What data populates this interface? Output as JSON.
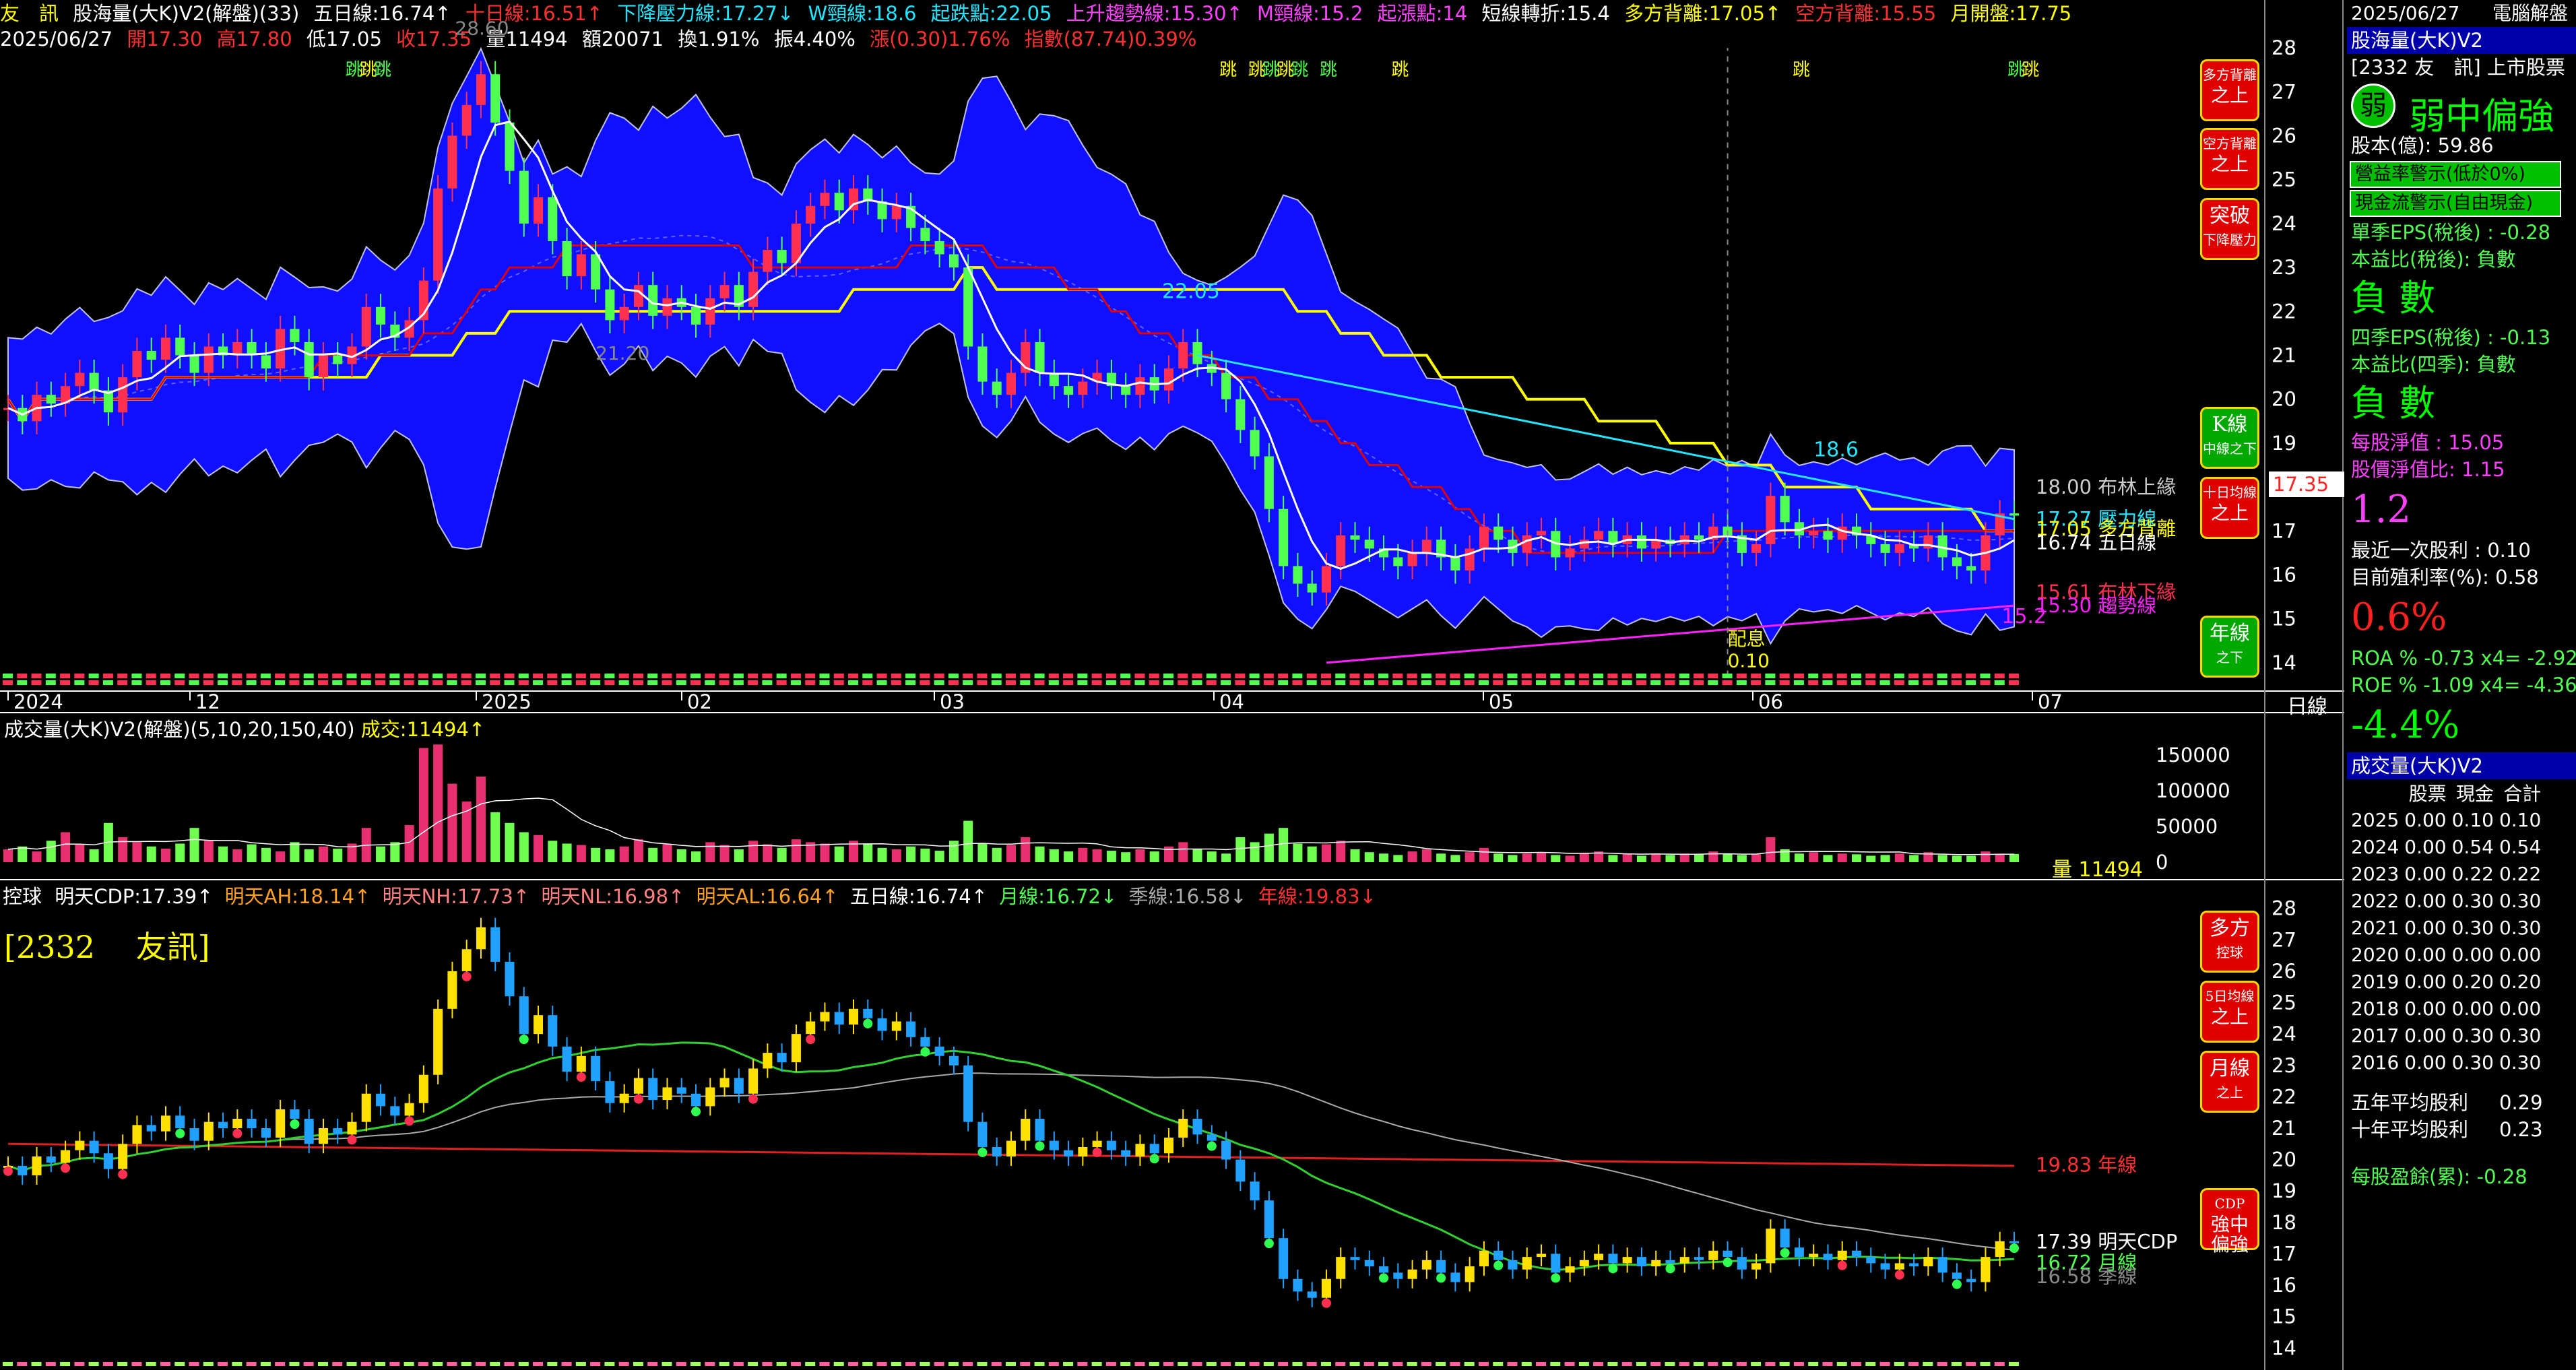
{
  "colors": {
    "up": "#ff3050",
    "down": "#50ff50",
    "band": "#1010ff",
    "yellow": "#ffff00",
    "cyan": "#22e6ff",
    "magenta": "#ff20ff",
    "red": "#ff2020"
  },
  "header1": {
    "stock": "友　訊",
    "indicator": "股海量(大K)V2(解盤)(33)",
    "ma5": "五日線:16.74↑",
    "ma10": "十日線:16.51↑",
    "down_pressure": "下降壓力線:17.27↓",
    "w_neck": "W頸線:18.6",
    "jump_down": "起跌點:22.05",
    "up_trend": "上升趨勢線:15.30↑",
    "m_neck": "M頸線:15.2",
    "jump_up": "起漲點:14",
    "short_turn": "短線轉折:15.4",
    "bull_div": "多方背離:17.05↑",
    "bear_div": "空方背離:15.55",
    "month_open": "月開盤:17.75"
  },
  "header2": {
    "date": "2025/06/27",
    "open": "開17.30",
    "high": "高17.80",
    "low": "低17.05",
    "close": "收17.35",
    "volume": "量11494",
    "amount": "額20071",
    "turnover": "換1.91%",
    "amplitude": "振4.40%",
    "change": "漲(0.30)1.76%",
    "index": "指數(87.74)0.39%"
  },
  "chart_data": [
    {
      "type": "candlestick",
      "title": "股海量(大K)V2(解盤)(33)",
      "x_ticks": [
        "2024",
        "12",
        "2025",
        "02",
        "03",
        "04",
        "05",
        "06",
        "07"
      ],
      "x_axis_label": "日線",
      "y_ticks": [
        14,
        15,
        16,
        17,
        18,
        19,
        20,
        21,
        22,
        23,
        24,
        25,
        26,
        27,
        28
      ],
      "ylim": [
        13.6,
        28.4
      ],
      "current_price": "17.35",
      "close_series": [
        19.8,
        19.5,
        20.1,
        19.9,
        20.3,
        20.6,
        20.2,
        19.7,
        20.5,
        21.1,
        20.9,
        21.4,
        21.0,
        20.6,
        21.2,
        21.0,
        21.3,
        21.0,
        20.7,
        21.6,
        21.3,
        20.5,
        21.0,
        20.8,
        21.2,
        22.1,
        21.7,
        21.4,
        21.8,
        22.7,
        24.8,
        26.0,
        26.7,
        27.4,
        26.3,
        25.2,
        24.0,
        24.6,
        23.6,
        22.8,
        23.3,
        22.5,
        21.8,
        22.1,
        22.6,
        21.9,
        22.3,
        22.1,
        21.7,
        22.3,
        22.6,
        22.1,
        22.9,
        23.4,
        23.1,
        24.0,
        24.4,
        24.7,
        24.3,
        24.8,
        24.5,
        24.1,
        24.4,
        23.9,
        23.6,
        23.3,
        23.0,
        21.2,
        20.4,
        20.1,
        20.6,
        21.3,
        20.6,
        20.3,
        20.1,
        20.4,
        20.6,
        20.3,
        20.1,
        20.5,
        20.2,
        20.7,
        21.3,
        20.8,
        20.6,
        20.0,
        19.3,
        18.7,
        17.5,
        16.2,
        15.8,
        15.6,
        16.2,
        16.9,
        16.8,
        16.6,
        16.4,
        16.2,
        16.5,
        16.8,
        16.4,
        16.1,
        16.6,
        17.1,
        16.8,
        16.5,
        16.9,
        17.0,
        16.4,
        16.6,
        16.8,
        17.0,
        16.7,
        16.9,
        16.6,
        16.8,
        16.7,
        16.9,
        16.8,
        17.1,
        16.9,
        16.5,
        16.7,
        17.8,
        17.2,
        16.9,
        17.0,
        16.8,
        17.1,
        16.9,
        16.7,
        16.5,
        16.7,
        16.6,
        16.9,
        16.4,
        16.2,
        16.1,
        16.9,
        17.4,
        17.35
      ],
      "ma_labels": [
        "18.00 布林上緣",
        "17.27 壓力線",
        "17.05 多方背離",
        "16.74 五日線",
        "15.61 布林下緣",
        "15.30 趨勢線"
      ],
      "annotations": {
        "high": "28.60",
        "low_mark": "21.20",
        "jump_down": "22.05",
        "w_neck": "18.6",
        "m_neck": "15.2",
        "dividend": "配息",
        "dividend_value": "0.10",
        "jump_label": "跳"
      }
    },
    {
      "type": "bar",
      "title": "成交量(大K)V2(解盤)(5,10,20,150,40)",
      "current": "成交:11494↑",
      "y_ticks": [
        "150000",
        "100000",
        "50000",
        "0"
      ],
      "ylim": [
        0,
        170000
      ],
      "volume_label": "量 11494",
      "values": [
        18000,
        22000,
        15000,
        30000,
        42000,
        25000,
        18000,
        55000,
        35000,
        28000,
        22000,
        19000,
        26000,
        48000,
        30000,
        22000,
        18000,
        25000,
        20000,
        15000,
        28000,
        18000,
        22000,
        19000,
        26000,
        48000,
        22000,
        28000,
        52000,
        160000,
        165000,
        110000,
        85000,
        120000,
        70000,
        55000,
        42000,
        38000,
        30000,
        26000,
        24000,
        20000,
        18000,
        22000,
        32000,
        20000,
        25000,
        18000,
        15000,
        28000,
        24000,
        18000,
        30000,
        25000,
        20000,
        32000,
        28000,
        26000,
        22000,
        30000,
        25000,
        20000,
        18000,
        22000,
        19000,
        16000,
        30000,
        58000,
        26000,
        20000,
        24000,
        35000,
        22000,
        18000,
        15000,
        20000,
        18000,
        16000,
        14000,
        18000,
        15000,
        22000,
        28000,
        18000,
        15000,
        12000,
        35000,
        28000,
        40000,
        48000,
        26000,
        22000,
        25000,
        30000,
        18000,
        14000,
        12000,
        10000,
        15000,
        18000,
        12000,
        10000,
        14000,
        20000,
        12000,
        10000,
        12000,
        14000,
        10000,
        9000,
        12000,
        15000,
        10000,
        11000,
        9000,
        12000,
        10000,
        12000,
        11000,
        15000,
        12000,
        10000,
        11000,
        35000,
        18000,
        12000,
        14000,
        10000,
        12000,
        11000,
        9000,
        10000,
        12000,
        10000,
        14000,
        10000,
        9000,
        9000,
        15000,
        12000,
        11494
      ]
    },
    {
      "type": "candlestick",
      "title": "控球",
      "stock_label": "[2332　 友訊]",
      "legend": [
        "明天CDP:17.39↑",
        "明天AH:18.14↑",
        "明天NH:17.73↑",
        "明天NL:16.98↑",
        "明天AL:16.64↑",
        "五日線:16.74↑",
        "月線:16.72↓",
        "季線:16.58↓",
        "年線:19.83↓"
      ],
      "y_ticks": [
        14,
        15,
        16,
        17,
        18,
        19,
        20,
        21,
        22,
        23,
        24,
        25,
        26,
        27,
        28
      ],
      "ylim": [
        13.6,
        28.4
      ],
      "line_labels": [
        "19.83 年線",
        "17.39 明天CDP",
        "16.72 月線",
        "16.58 季線"
      ]
    }
  ],
  "side_buttons_top": [
    {
      "name": "bull-div-above",
      "l1": "多方背離",
      "l2": "之上",
      "color": "red"
    },
    {
      "name": "bear-div-above",
      "l1": "空方背離",
      "l2": "之上",
      "color": "red"
    },
    {
      "name": "breakout",
      "l1": "突破",
      "l2": "下降壓力",
      "color": "red"
    },
    {
      "name": "k-line",
      "l1": "K線",
      "l2": "中線之下",
      "color": "green"
    },
    {
      "name": "ma10-above",
      "l1": "十日均線",
      "l2": "之上",
      "color": "red"
    },
    {
      "name": "year-line-below",
      "l1": "年線",
      "l2": "之下",
      "color": "green"
    }
  ],
  "side_buttons_bottom": [
    {
      "name": "bull-control",
      "l1": "多方",
      "l2": "控球",
      "color": "red"
    },
    {
      "name": "ma5-above",
      "l1": "5日均線",
      "l2": "之上",
      "color": "red"
    },
    {
      "name": "month-line-above",
      "l1": "月線",
      "l2": "之上",
      "color": "red"
    },
    {
      "name": "cdp",
      "l1": "CDP",
      "l2": "強中偏強",
      "color": "red"
    }
  ],
  "right_panel": {
    "date": "2025/06/27",
    "mode": "電腦解盤",
    "title": "股海量(大K)V2",
    "stock": "[2332 友　訊] 上市股票",
    "strength_badge": "弱",
    "strength": "弱中偏強",
    "capital": "股本(億): 59.86",
    "warn1": "營益率警示(低於0%)",
    "warn2": "現金流警示(自由現金)",
    "eps_q": "單季EPS(稅後) : -0.28",
    "pe_q": "本益比(稅後): 負數",
    "neg1": "負 數",
    "eps_4q": "四季EPS(稅後) : -0.13",
    "pe_4q": "本益比(四季): 負數",
    "neg2": "負 數",
    "nav": "每股淨值 : 15.05",
    "pb": "股價淨值比: 1.15",
    "pb_big": "1.2",
    "last_div": "最近一次股利 : 0.10",
    "yield": "目前殖利率(%): 0.58",
    "yield_big": "0.6%",
    "roa": "ROA % -0.73 x4= -2.92",
    "roe": "ROE % -1.09 x4= -4.36",
    "roe_big": "-4.4%",
    "vol_title": "成交量(大K)V2",
    "div_header": [
      "股票",
      "現金",
      "合計"
    ],
    "dividends": [
      [
        "2025",
        "0.00",
        "0.10",
        "0.10"
      ],
      [
        "2024",
        "0.00",
        "0.54",
        "0.54"
      ],
      [
        "2023",
        "0.00",
        "0.22",
        "0.22"
      ],
      [
        "2022",
        "0.00",
        "0.30",
        "0.30"
      ],
      [
        "2021",
        "0.00",
        "0.30",
        "0.30"
      ],
      [
        "2020",
        "0.00",
        "0.00",
        "0.00"
      ],
      [
        "2019",
        "0.00",
        "0.20",
        "0.20"
      ],
      [
        "2018",
        "0.00",
        "0.00",
        "0.00"
      ],
      [
        "2017",
        "0.00",
        "0.30",
        "0.30"
      ],
      [
        "2016",
        "0.00",
        "0.30",
        "0.30"
      ]
    ],
    "avg5_label": "五年平均股利",
    "avg5": "0.29",
    "avg10_label": "十年平均股利",
    "avg10": "0.23",
    "eps_cum": "每股盈餘(累): -0.28"
  }
}
